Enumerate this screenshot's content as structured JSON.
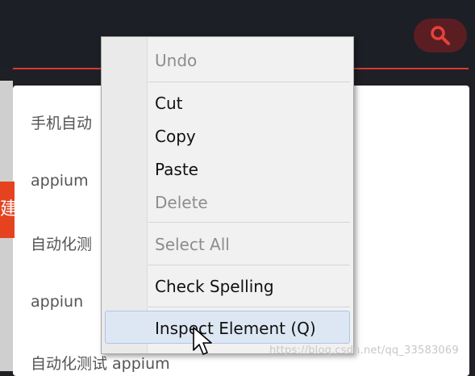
{
  "page": {
    "list_items": [
      "手机自动",
      "appium",
      "自动化测",
      "appiun",
      "自动化测试 appium"
    ],
    "side_tab_char": "建"
  },
  "context_menu": {
    "items": [
      {
        "label": "Undo",
        "disabled": true
      },
      {
        "label": "Cut",
        "disabled": false
      },
      {
        "label": "Copy",
        "disabled": false
      },
      {
        "label": "Paste",
        "disabled": false
      },
      {
        "label": "Delete",
        "disabled": true
      },
      {
        "label": "Select All",
        "disabled": true
      },
      {
        "label": "Check Spelling",
        "disabled": false
      },
      {
        "label": "Inspect Element (Q)",
        "disabled": false,
        "hovered": true
      }
    ]
  },
  "watermark": "https://blog.csdn.net/qq_33583069",
  "icons": {
    "search": "search-icon",
    "cursor": "mouse-pointer-icon"
  },
  "colors": {
    "accent": "#d5392e",
    "topbar": "#1c1f26",
    "orange_tab": "#e5421f",
    "hover": "#dde7f3"
  }
}
